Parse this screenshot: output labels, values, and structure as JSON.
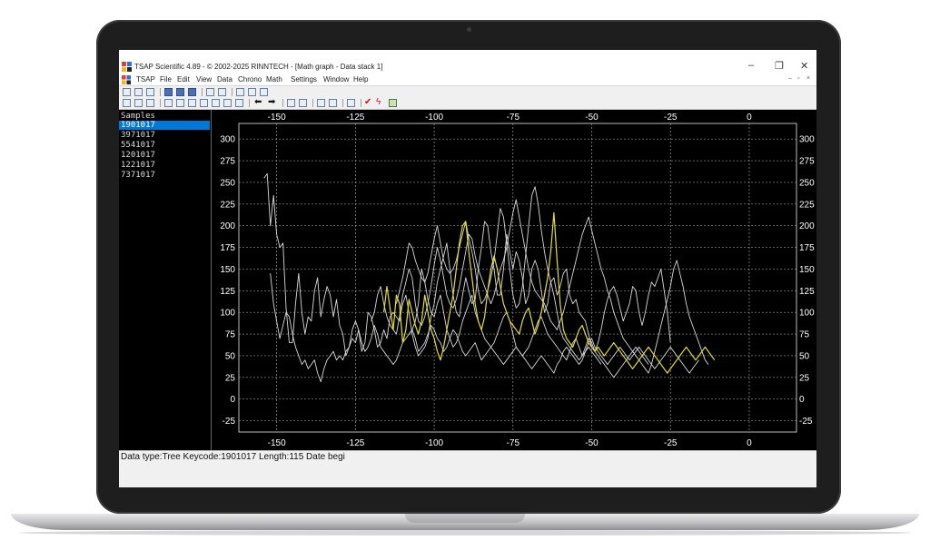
{
  "window": {
    "title": "TSAP Scientific 4.89 - © 2002-2025 RINNTECH - [Math graph - Data stack 1]",
    "minimize": "–",
    "restore": "❐",
    "close": "✕",
    "mdi_minimize": "–",
    "mdi_restore": "▫",
    "mdi_close": "×"
  },
  "menu": [
    "TSAP",
    "File",
    "Edit",
    "View",
    "Data",
    "Chrono",
    "Math",
    "Settings",
    "Window",
    "Help"
  ],
  "samples": {
    "title": "Samples",
    "items": [
      "1901017",
      "3971017",
      "5541017",
      "1201017",
      "1221017",
      "7371017"
    ],
    "selected_index": 0
  },
  "status": {
    "text": "Data type:Tree  Keycode:1901017  Length:115  Date begi"
  },
  "colors": {
    "series_default": "#d8d8d8",
    "series_highlight": "#e6dd2c",
    "grid": "#9a9a9a",
    "axis_text": "#ffffff",
    "selection": "#0078d7"
  },
  "chart_data": {
    "type": "line",
    "xlim": [
      -162,
      15
    ],
    "ylim": [
      -38,
      318
    ],
    "x_ticks": [
      "-150",
      "-125",
      "-100",
      "-75",
      "-50",
      "-25",
      "0"
    ],
    "x_tick_values": [
      -150,
      -125,
      -100,
      -75,
      -50,
      -25,
      0
    ],
    "y_ticks": [
      "300",
      "275",
      "250",
      "225",
      "200",
      "175",
      "150",
      "125",
      "100",
      "75",
      "50",
      "25",
      "0",
      "-25"
    ],
    "y_tick_values": [
      300,
      275,
      250,
      225,
      200,
      175,
      150,
      125,
      100,
      75,
      50,
      25,
      0,
      -25
    ],
    "grid": true,
    "series": [
      {
        "highlight": false,
        "x_start": -154,
        "values": [
          255,
          260,
          200,
          235,
          190,
          175,
          180,
          105,
          65,
          65,
          110,
          145,
          100,
          75,
          95,
          90,
          125,
          140,
          95,
          115,
          130,
          120,
          95,
          115,
          85,
          75,
          50,
          60,
          80,
          90,
          80,
          55,
          65,
          100,
          95,
          80,
          60,
          65,
          80,
          70,
          95,
          100,
          95,
          90,
          110,
          120,
          100,
          75,
          60,
          50,
          55,
          60,
          70,
          95,
          110,
          135,
          150,
          165,
          180,
          150,
          120,
          100,
          95,
          120,
          140,
          125,
          110,
          115,
          150,
          175,
          205,
          200,
          170,
          150,
          120,
          120,
          150,
          190,
          170,
          150,
          170,
          160,
          140,
          110,
          120,
          150,
          160,
          150,
          125,
          100,
          110,
          135,
          140,
          120,
          130,
          145,
          150,
          120,
          110,
          115,
          100,
          95,
          90,
          75,
          60,
          55,
          65,
          80,
          100,
          115,
          125,
          130,
          120,
          105,
          90,
          100,
          110,
          130,
          125,
          100,
          85,
          100,
          120,
          135,
          130,
          140,
          150,
          125,
          100,
          65
        ]
      },
      {
        "highlight": false,
        "x_start": -152,
        "values": [
          145,
          110,
          90,
          70,
          85,
          100,
          95,
          75,
          60,
          50,
          40,
          45,
          35,
          40,
          45,
          30,
          20,
          35,
          45,
          50,
          55,
          45,
          50,
          45,
          55,
          60,
          70,
          65,
          80,
          65,
          55,
          60,
          70,
          85,
          75,
          60,
          55,
          50,
          45,
          40,
          45,
          55,
          65,
          70,
          75,
          80,
          70,
          55,
          60,
          65,
          75,
          85,
          80,
          70,
          65,
          55,
          60,
          70,
          80,
          75,
          65,
          55,
          50,
          55,
          60,
          65,
          55,
          45,
          50,
          55,
          60,
          55,
          50,
          45,
          40,
          45,
          50,
          55,
          60,
          55,
          50,
          45,
          40,
          35,
          40,
          45,
          50,
          45,
          40,
          35,
          30,
          40,
          45,
          55,
          60,
          55,
          50,
          45,
          40,
          45,
          55,
          60,
          55,
          50,
          45,
          40
        ]
      },
      {
        "highlight": false,
        "x_start": -120,
        "values": [
          90,
          100,
          120,
          130,
          110,
          95,
          85,
          80,
          75,
          95,
          120,
          135,
          150,
          140,
          110,
          90,
          85,
          95,
          110,
          130,
          155,
          175,
          160,
          140,
          120,
          110,
          105,
          115,
          130,
          150,
          170,
          190,
          185,
          165,
          150,
          140,
          130,
          120,
          110,
          120,
          135,
          150,
          160,
          175,
          195,
          215,
          230,
          210,
          190,
          170,
          150,
          135,
          125,
          120,
          115,
          110,
          100,
          90,
          85,
          80,
          90,
          100,
          115,
          130,
          145,
          160,
          175,
          190,
          200,
          210,
          195,
          180,
          165,
          150,
          140,
          125,
          115,
          100,
          90,
          80,
          70,
          65,
          60,
          55,
          50,
          45,
          40,
          35,
          30,
          40,
          55,
          70,
          85,
          100,
          115,
          130,
          150,
          160,
          145,
          130,
          110,
          95,
          85,
          75,
          65,
          55,
          45,
          40
        ]
      },
      {
        "highlight": false,
        "x_start": -112,
        "values": [
          110,
          125,
          140,
          160,
          180,
          175,
          160,
          150,
          140,
          135,
          145,
          165,
          185,
          200,
          180,
          160,
          150,
          145,
          150,
          160,
          175,
          190,
          205,
          185,
          170,
          150,
          125,
          110,
          115,
          125,
          140,
          160,
          190,
          220,
          210,
          180,
          150,
          120,
          105,
          110,
          130,
          165,
          200,
          235,
          245,
          225,
          195,
          170,
          150,
          135,
          120,
          100,
          80,
          70,
          65,
          60,
          55,
          50,
          45,
          50,
          60,
          70,
          65,
          55,
          50,
          45,
          40,
          35,
          30,
          25,
          30,
          35,
          40,
          45,
          50,
          55,
          60,
          55,
          50,
          45,
          40
        ]
      },
      {
        "highlight": false,
        "x_start": -108,
        "values": [
          75,
          80,
          90,
          110,
          150,
          135,
          115,
          100,
          95,
          110,
          120,
          100,
          80,
          70,
          60,
          65,
          75,
          90,
          100,
          110,
          120,
          100,
          90,
          80,
          70,
          65,
          60,
          65,
          75,
          85,
          95,
          100,
          90,
          75,
          60,
          55,
          50,
          55,
          60,
          70,
          80,
          90,
          95,
          85,
          75,
          70,
          65,
          60,
          55,
          50,
          45,
          55,
          65,
          70,
          60,
          50,
          55,
          65,
          70,
          60,
          55,
          50,
          45,
          40,
          45,
          50,
          55,
          60,
          55,
          50,
          45,
          50,
          55,
          60,
          55,
          50,
          45,
          40,
          35,
          40,
          45,
          50,
          55,
          60,
          55,
          50,
          45,
          40,
          35,
          30,
          35,
          40,
          45
        ]
      },
      {
        "highlight": true,
        "x_start": -116,
        "values": [
          100,
          130,
          105,
          80,
          120,
          110,
          65,
          80,
          115,
          100,
          85,
          75,
          90,
          120,
          100,
          80,
          70,
          55,
          45,
          60,
          80,
          100,
          120,
          150,
          180,
          200,
          205,
          170,
          140,
          110,
          90,
          80,
          95,
          125,
          150,
          165,
          150,
          130,
          110,
          100,
          90,
          85,
          80,
          75,
          90,
          100,
          105,
          90,
          75,
          85,
          100,
          120,
          140,
          170,
          215,
          160,
          110,
          80,
          70,
          65,
          60,
          70,
          80,
          85,
          75,
          65,
          60,
          55,
          60,
          55,
          50,
          55,
          60,
          65,
          60,
          55,
          50,
          45,
          40,
          35,
          40,
          45,
          50,
          55,
          60,
          55,
          50,
          45,
          40,
          35,
          30,
          35,
          40,
          45,
          50,
          55,
          60,
          55,
          50,
          45,
          50,
          55,
          60,
          55,
          50,
          45
        ]
      }
    ]
  }
}
